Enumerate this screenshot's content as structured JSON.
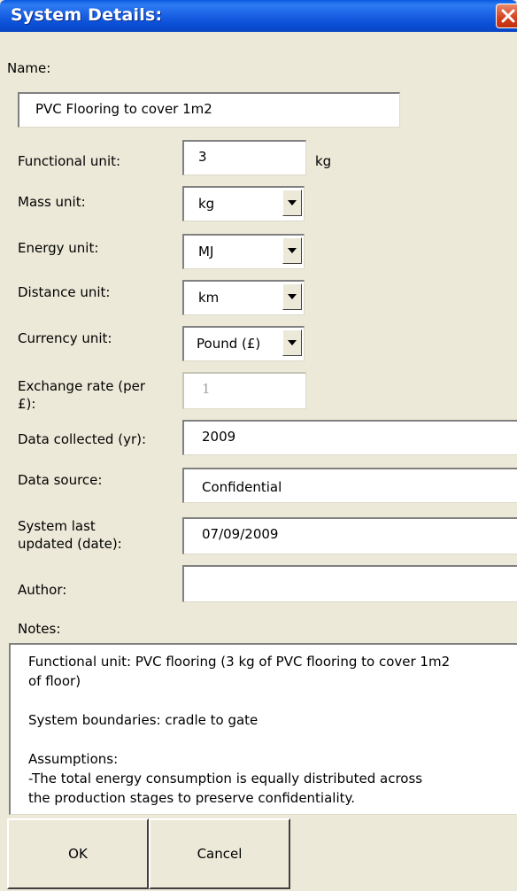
{
  "window": {
    "title": "System Details:"
  },
  "form": {
    "name_label": "Name:",
    "name_value": "PVC Flooring to cover 1m2",
    "functional_unit_label": "Functional unit:",
    "functional_unit_value": "3",
    "functional_unit_unit": "kg",
    "mass_unit_label": "Mass unit:",
    "mass_unit_value": "kg",
    "energy_unit_label": "Energy unit:",
    "energy_unit_value": "MJ",
    "distance_unit_label": "Distance unit:",
    "distance_unit_value": "km",
    "currency_unit_label": "Currency unit:",
    "currency_unit_value": "Pound (£)",
    "exchange_rate_label_line1": "Exchange rate (per",
    "exchange_rate_label_line2": "£):",
    "exchange_rate_value": "1",
    "data_collected_label": "Data collected (yr):",
    "data_collected_value": "2009",
    "data_source_label": "Data source:",
    "data_source_value": "Confidential",
    "last_updated_label_line1": "System last",
    "last_updated_label_line2": "updated (date):",
    "last_updated_value": "07/09/2009",
    "author_label": "Author:",
    "author_value": "",
    "notes_label": "Notes:",
    "notes_para1_line1": "Functional unit: PVC flooring (3 kg of PVC flooring to cover 1m2",
    "notes_para1_line2": "of floor)",
    "notes_para2": "System boundaries: cradle to gate",
    "notes_para3_line1": "Assumptions:",
    "notes_para3_line2": "-The total energy consumption is equally distributed across",
    "notes_para3_line3": "the production stages to preserve confidentiality."
  },
  "buttons": {
    "ok": "OK",
    "cancel": "Cancel"
  }
}
